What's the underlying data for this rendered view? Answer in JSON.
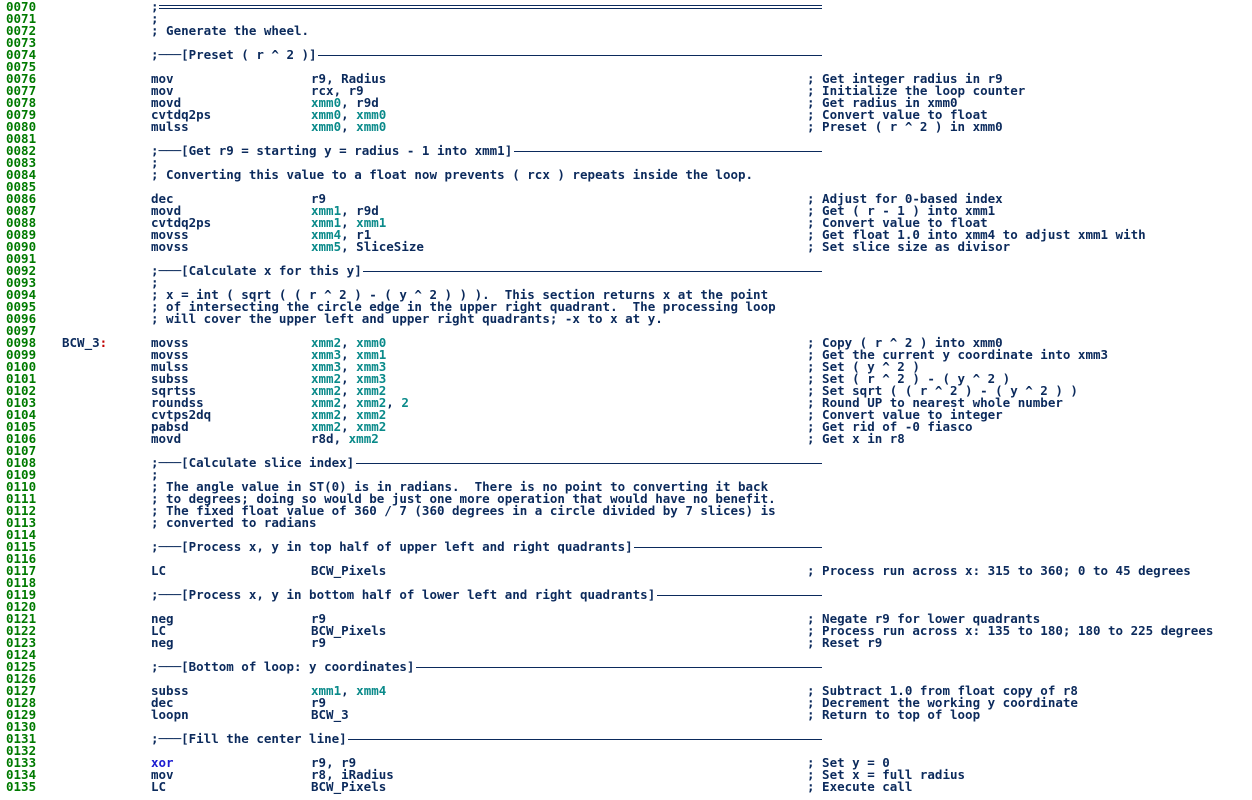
{
  "editor": {
    "lines": [
      {
        "n": "0070",
        "kind": "ruleline",
        "style": "double"
      },
      {
        "n": "0071",
        "kind": "comment",
        "text": ";"
      },
      {
        "n": "0072",
        "kind": "comment",
        "text": "; Generate the wheel."
      },
      {
        "n": "0073",
        "kind": "blank"
      },
      {
        "n": "0074",
        "kind": "section",
        "title": "[Preset ( r ^ 2 )]"
      },
      {
        "n": "0075",
        "kind": "blank"
      },
      {
        "n": "0076",
        "kind": "code",
        "mn": "mov",
        "ops": [
          {
            "t": "r9"
          },
          {
            "t": ", "
          },
          {
            "t": "Radius"
          }
        ],
        "cm": "; Get integer radius in r9"
      },
      {
        "n": "0077",
        "kind": "code",
        "mn": "mov",
        "ops": [
          {
            "t": "rcx"
          },
          {
            "t": ", "
          },
          {
            "t": "r9"
          }
        ],
        "cm": "; Initialize the loop counter"
      },
      {
        "n": "0078",
        "kind": "code",
        "mn": "movd",
        "ops": [
          {
            "t": "xmm0",
            "c": "reg"
          },
          {
            "t": ", "
          },
          {
            "t": "r9d"
          }
        ],
        "cm": "; Get radius in xmm0"
      },
      {
        "n": "0079",
        "kind": "code",
        "mn": "cvtdq2ps",
        "ops": [
          {
            "t": "xmm0",
            "c": "reg"
          },
          {
            "t": ", "
          },
          {
            "t": "xmm0",
            "c": "reg"
          }
        ],
        "cm": "; Convert value to float"
      },
      {
        "n": "0080",
        "kind": "code",
        "mn": "mulss",
        "ops": [
          {
            "t": "xmm0",
            "c": "reg"
          },
          {
            "t": ", "
          },
          {
            "t": "xmm0",
            "c": "reg"
          }
        ],
        "cm": "; Preset ( r ^ 2 ) in xmm0"
      },
      {
        "n": "0081",
        "kind": "blank"
      },
      {
        "n": "0082",
        "kind": "section",
        "title": "[Get r9 = starting y = radius - 1 into xmm1]"
      },
      {
        "n": "0083",
        "kind": "comment",
        "text": ";"
      },
      {
        "n": "0084",
        "kind": "comment",
        "text": "; Converting this value to a float now prevents ( rcx ) repeats inside the loop."
      },
      {
        "n": "0085",
        "kind": "blank"
      },
      {
        "n": "0086",
        "kind": "code",
        "mn": "dec",
        "ops": [
          {
            "t": "r9"
          }
        ],
        "cm": "; Adjust for 0-based index"
      },
      {
        "n": "0087",
        "kind": "code",
        "mn": "movd",
        "ops": [
          {
            "t": "xmm1",
            "c": "reg"
          },
          {
            "t": ", "
          },
          {
            "t": "r9d"
          }
        ],
        "cm": "; Get ( r - 1 ) into xmm1"
      },
      {
        "n": "0088",
        "kind": "code",
        "mn": "cvtdq2ps",
        "ops": [
          {
            "t": "xmm1",
            "c": "reg"
          },
          {
            "t": ", "
          },
          {
            "t": "xmm1",
            "c": "reg"
          }
        ],
        "cm": "; Convert value to float"
      },
      {
        "n": "0089",
        "kind": "code",
        "mn": "movss",
        "ops": [
          {
            "t": "xmm4",
            "c": "reg"
          },
          {
            "t": ", "
          },
          {
            "t": "r1"
          }
        ],
        "cm": "; Get float 1.0 into xmm4 to adjust xmm1 with"
      },
      {
        "n": "0090",
        "kind": "code",
        "mn": "movss",
        "ops": [
          {
            "t": "xmm5",
            "c": "reg"
          },
          {
            "t": ", "
          },
          {
            "t": "SliceSize"
          }
        ],
        "cm": "; Set slice size as divisor"
      },
      {
        "n": "0091",
        "kind": "blank"
      },
      {
        "n": "0092",
        "kind": "section",
        "title": "[Calculate x for this y]"
      },
      {
        "n": "0093",
        "kind": "comment",
        "text": ";"
      },
      {
        "n": "0094",
        "kind": "comment",
        "text": "; x = int ( sqrt ( ( r ^ 2 ) - ( y ^ 2 ) ) ).  This section returns x at the point"
      },
      {
        "n": "0095",
        "kind": "comment",
        "text": "; of intersecting the circle edge in the upper right quadrant.  The processing loop"
      },
      {
        "n": "0096",
        "kind": "comment",
        "text": "; will cover the upper left and upper right quadrants; -x to x at y."
      },
      {
        "n": "0097",
        "kind": "blank"
      },
      {
        "n": "0098",
        "kind": "code",
        "label": "BCW_3",
        "mn": "movss",
        "ops": [
          {
            "t": "xmm2",
            "c": "reg"
          },
          {
            "t": ", "
          },
          {
            "t": "xmm0",
            "c": "reg"
          }
        ],
        "cm": "; Copy ( r ^ 2 ) into xmm0"
      },
      {
        "n": "0099",
        "kind": "code",
        "mn": "movss",
        "ops": [
          {
            "t": "xmm3",
            "c": "reg"
          },
          {
            "t": ", "
          },
          {
            "t": "xmm1",
            "c": "reg"
          }
        ],
        "cm": "; Get the current y coordinate into xmm3"
      },
      {
        "n": "0100",
        "kind": "code",
        "mn": "mulss",
        "ops": [
          {
            "t": "xmm3",
            "c": "reg"
          },
          {
            "t": ", "
          },
          {
            "t": "xmm3",
            "c": "reg"
          }
        ],
        "cm": "; Set ( y ^ 2 )"
      },
      {
        "n": "0101",
        "kind": "code",
        "mn": "subss",
        "ops": [
          {
            "t": "xmm2",
            "c": "reg"
          },
          {
            "t": ", "
          },
          {
            "t": "xmm3",
            "c": "reg"
          }
        ],
        "cm": "; Set ( r ^ 2 ) - ( y ^ 2 )"
      },
      {
        "n": "0102",
        "kind": "code",
        "mn": "sqrtss",
        "ops": [
          {
            "t": "xmm2",
            "c": "reg"
          },
          {
            "t": ", "
          },
          {
            "t": "xmm2",
            "c": "reg"
          }
        ],
        "cm": "; Set sqrt ( ( r ^ 2 ) - ( y ^ 2 ) )"
      },
      {
        "n": "0103",
        "kind": "code",
        "mn": "roundss",
        "ops": [
          {
            "t": "xmm2",
            "c": "reg"
          },
          {
            "t": ", "
          },
          {
            "t": "xmm2",
            "c": "reg"
          },
          {
            "t": ", "
          },
          {
            "t": "2",
            "c": "num"
          }
        ],
        "cm": "; Round UP to nearest whole number"
      },
      {
        "n": "0104",
        "kind": "code",
        "mn": "cvtps2dq",
        "ops": [
          {
            "t": "xmm2",
            "c": "reg"
          },
          {
            "t": ", "
          },
          {
            "t": "xmm2",
            "c": "reg"
          }
        ],
        "cm": "; Convert value to integer"
      },
      {
        "n": "0105",
        "kind": "code",
        "mn": "pabsd",
        "ops": [
          {
            "t": "xmm2",
            "c": "reg"
          },
          {
            "t": ", "
          },
          {
            "t": "xmm2",
            "c": "reg"
          }
        ],
        "cm": "; Get rid of -0 fiasco"
      },
      {
        "n": "0106",
        "kind": "code",
        "mn": "movd",
        "ops": [
          {
            "t": "r8d"
          },
          {
            "t": ", "
          },
          {
            "t": "xmm2",
            "c": "reg"
          }
        ],
        "cm": "; Get x in r8"
      },
      {
        "n": "0107",
        "kind": "blank"
      },
      {
        "n": "0108",
        "kind": "section",
        "title": "[Calculate slice index]"
      },
      {
        "n": "0109",
        "kind": "comment",
        "text": ";"
      },
      {
        "n": "0110",
        "kind": "comment",
        "text": "; The angle value in ST(0) is in radians.  There is no point to converting it back"
      },
      {
        "n": "0111",
        "kind": "comment",
        "text": "; to degrees; doing so would be just one more operation that would have no benefit."
      },
      {
        "n": "0112",
        "kind": "comment",
        "text": "; The fixed float value of 360 / 7 (360 degrees in a circle divided by 7 slices) is"
      },
      {
        "n": "0113",
        "kind": "comment",
        "text": "; converted to radians"
      },
      {
        "n": "0114",
        "kind": "blank"
      },
      {
        "n": "0115",
        "kind": "section",
        "title": "[Process x, y in top half of upper left and right quadrants]"
      },
      {
        "n": "0116",
        "kind": "blank"
      },
      {
        "n": "0117",
        "kind": "code",
        "mn": "LC",
        "ops": [
          {
            "t": "BCW_Pixels"
          }
        ],
        "cm": "; Process run across x: 315 to 360; 0 to 45 degrees"
      },
      {
        "n": "0118",
        "kind": "blank"
      },
      {
        "n": "0119",
        "kind": "section",
        "title": "[Process x, y in bottom half of lower left and right quadrants]"
      },
      {
        "n": "0120",
        "kind": "blank"
      },
      {
        "n": "0121",
        "kind": "code",
        "mn": "neg",
        "ops": [
          {
            "t": "r9"
          }
        ],
        "cm": "; Negate r9 for lower quadrants"
      },
      {
        "n": "0122",
        "kind": "code",
        "mn": "LC",
        "ops": [
          {
            "t": "BCW_Pixels"
          }
        ],
        "cm": "; Process run across x: 135 to 180; 180 to 225 degrees"
      },
      {
        "n": "0123",
        "kind": "code",
        "mn": "neg",
        "ops": [
          {
            "t": "r9"
          }
        ],
        "cm": "; Reset r9"
      },
      {
        "n": "0124",
        "kind": "blank"
      },
      {
        "n": "0125",
        "kind": "section",
        "title": "[Bottom of loop: y coordinates]"
      },
      {
        "n": "0126",
        "kind": "blank"
      },
      {
        "n": "0127",
        "kind": "code",
        "mn": "subss",
        "ops": [
          {
            "t": "xmm1",
            "c": "reg"
          },
          {
            "t": ", "
          },
          {
            "t": "xmm4",
            "c": "reg"
          }
        ],
        "cm": "; Subtract 1.0 from float copy of r8"
      },
      {
        "n": "0128",
        "kind": "code",
        "mn": "dec",
        "ops": [
          {
            "t": "r9"
          }
        ],
        "cm": "; Decrement the working y coordinate"
      },
      {
        "n": "0129",
        "kind": "code",
        "mn": "loopn",
        "ops": [
          {
            "t": "BCW_3"
          }
        ],
        "cm": "; Return to top of loop"
      },
      {
        "n": "0130",
        "kind": "blank"
      },
      {
        "n": "0131",
        "kind": "section",
        "title": "[Fill the center line]"
      },
      {
        "n": "0132",
        "kind": "blank"
      },
      {
        "n": "0133",
        "kind": "code",
        "mn": "xor",
        "mnc": "kw",
        "ops": [
          {
            "t": "r9"
          },
          {
            "t": ", "
          },
          {
            "t": "r9"
          }
        ],
        "cm": "; Set y = 0"
      },
      {
        "n": "0134",
        "kind": "code",
        "mn": "mov",
        "ops": [
          {
            "t": "r8"
          },
          {
            "t": ", "
          },
          {
            "t": "iRadius"
          }
        ],
        "cm": "; Set x = full radius"
      },
      {
        "n": "0135",
        "kind": "code",
        "mn": "LC",
        "ops": [
          {
            "t": "BCW_Pixels"
          }
        ],
        "cm": "; Execute call"
      }
    ]
  }
}
